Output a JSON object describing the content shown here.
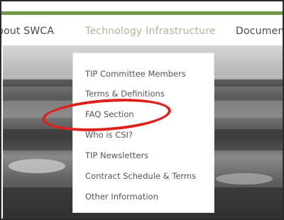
{
  "nav": {
    "items": [
      {
        "label": "bout SWCA"
      },
      {
        "label": "Technology Infrastructure"
      },
      {
        "label": "Documen"
      }
    ]
  },
  "dropdown": {
    "items": [
      {
        "label": "TIP Committee Members"
      },
      {
        "label": "Terms & Definitions"
      },
      {
        "label": "FAQ Section"
      },
      {
        "label": "Who is CSI?"
      },
      {
        "label": "TIP Newsletters"
      },
      {
        "label": "Contract Schedule & Terms"
      },
      {
        "label": "Other Information"
      }
    ]
  },
  "colors": {
    "accent_green": "#6d9b45",
    "active_nav": "#a8b99a",
    "annotation_red": "#e0201c"
  }
}
